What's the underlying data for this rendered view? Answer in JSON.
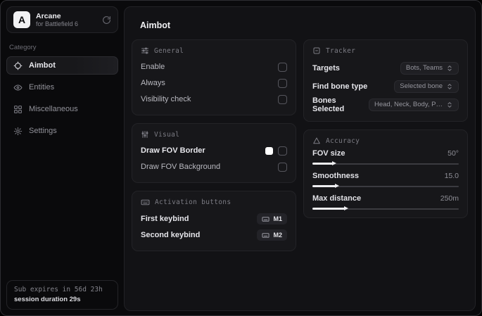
{
  "app": {
    "name": "Arcane",
    "subtitle": "for Battlefield 6",
    "logo_letter": "A"
  },
  "sidebar": {
    "category_label": "Category",
    "items": [
      {
        "label": "Aimbot",
        "icon": "crosshair-icon",
        "active": true
      },
      {
        "label": "Entities",
        "icon": "entities-icon",
        "active": false
      },
      {
        "label": "Miscellaneous",
        "icon": "grid-icon",
        "active": false
      },
      {
        "label": "Settings",
        "icon": "gear-icon",
        "active": false
      }
    ],
    "subscription": {
      "expires_text": "Sub expires in 56d 23h",
      "session_text": "session duration 29s"
    }
  },
  "main": {
    "title": "Aimbot",
    "general": {
      "title": "General",
      "rows": [
        {
          "label": "Enable",
          "checked": false
        },
        {
          "label": "Always",
          "checked": false
        },
        {
          "label": "Visibility check",
          "checked": false
        }
      ]
    },
    "visual": {
      "title": "Visual",
      "rows": [
        {
          "label": "Draw FOV Border",
          "swatch_color": "#ffffff",
          "checked": false
        },
        {
          "label": "Draw FOV Background",
          "checked": false
        }
      ]
    },
    "activation": {
      "title": "Activation buttons",
      "rows": [
        {
          "label": "First keybind",
          "key": "M1"
        },
        {
          "label": "Second keybind",
          "key": "M2"
        }
      ]
    },
    "tracker": {
      "title": "Tracker",
      "rows": [
        {
          "label": "Targets",
          "value": "Bots, Teams"
        },
        {
          "label": "Find bone type",
          "value": "Selected bone"
        },
        {
          "label": "Bones Selected",
          "value": "Head, Neck, Body, Pe..."
        }
      ]
    },
    "accuracy": {
      "title": "Accuracy",
      "sliders": [
        {
          "label": "FOV size",
          "value": "50°",
          "fill_pct": 14
        },
        {
          "label": "Smoothness",
          "value": "15.0",
          "fill_pct": 16
        },
        {
          "label": "Max distance",
          "value": "250m",
          "fill_pct": 22
        }
      ]
    }
  },
  "colors": {
    "accent": "#ffffff",
    "window_bg": "#0a0a0c",
    "card_bg": "#17171a"
  }
}
